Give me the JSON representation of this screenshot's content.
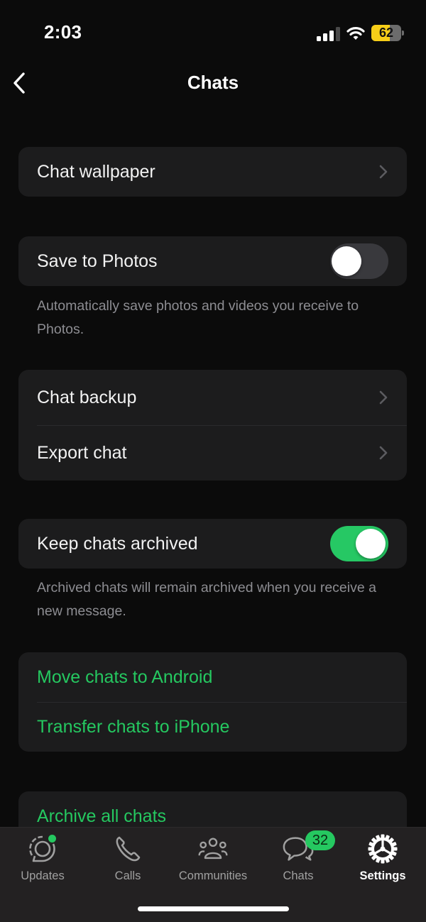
{
  "status_bar": {
    "time": "2:03",
    "battery_percent": 62,
    "battery_label": "62",
    "signal_bars": 3,
    "signal_bars_max": 4,
    "icons": [
      "cellular-signal-icon",
      "wifi-icon",
      "battery-icon"
    ]
  },
  "nav": {
    "back_icon": "chevron-left-icon",
    "title": "Chats"
  },
  "sections": {
    "wallpaper": {
      "label": "Chat wallpaper",
      "icon": "chevron-right-icon"
    },
    "save_to_photos": {
      "label": "Save to Photos",
      "enabled": false,
      "footer": "Automatically save photos and videos you receive to Photos."
    },
    "backup": {
      "items": [
        {
          "label": "Chat backup",
          "icon": "chevron-right-icon"
        },
        {
          "label": "Export chat",
          "icon": "chevron-right-icon"
        }
      ]
    },
    "keep_archived": {
      "label": "Keep chats archived",
      "enabled": true,
      "footer": "Archived chats will remain archived when you receive a new message."
    },
    "transfer": {
      "items": [
        {
          "label": "Move chats to Android"
        },
        {
          "label": "Transfer chats to iPhone"
        }
      ]
    },
    "archive": {
      "items": [
        {
          "label": "Archive all chats"
        }
      ]
    }
  },
  "tab_bar": {
    "active": "Settings",
    "tabs": [
      {
        "label": "Updates",
        "icon": "updates-icon",
        "has_dot": true
      },
      {
        "label": "Calls",
        "icon": "phone-icon"
      },
      {
        "label": "Communities",
        "icon": "communities-icon"
      },
      {
        "label": "Chats",
        "icon": "chat-bubbles-icon",
        "badge": "32"
      },
      {
        "label": "Settings",
        "icon": "gear-icon"
      }
    ]
  },
  "colors": {
    "accent_green": "#25c860",
    "background": "#0b0b0b",
    "cell_background": "#1c1c1d",
    "battery_yellow": "#f7ce18"
  }
}
